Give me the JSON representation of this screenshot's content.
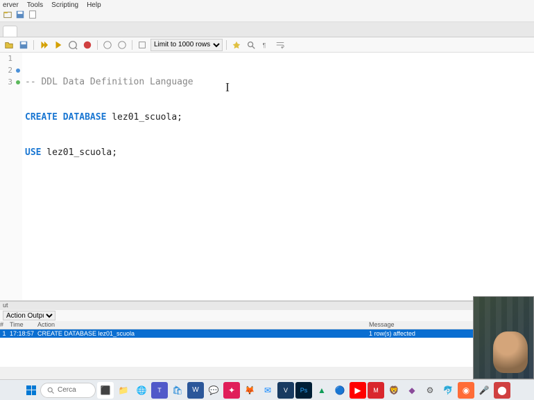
{
  "menu": {
    "items": [
      "erver",
      "Tools",
      "Scripting",
      "Help"
    ]
  },
  "toolbar2": {
    "limit_label": "Limit to 1000 rows"
  },
  "editor": {
    "lines": [
      {
        "num": "1",
        "marker": "",
        "comment": "-- DDL Data Definition Language"
      },
      {
        "num": "2",
        "marker": "blue",
        "kw1": "CREATE DATABASE",
        "ident": " lez01_scuola;"
      },
      {
        "num": "3",
        "marker": "green",
        "kw1": "USE",
        "ident": " lez01_scuola;"
      }
    ]
  },
  "output": {
    "tab": "ut",
    "dropdown": "Action Output",
    "headers": {
      "num": "#",
      "time": "Time",
      "action": "Action",
      "message": "Message"
    },
    "row": {
      "num": "1",
      "time": "17:18:57",
      "action": "CREATE DATABASE lez01_scuola",
      "message": "1 row(s) affected"
    }
  },
  "taskbar": {
    "search_placeholder": "Cerca",
    "icons": [
      "widgets",
      "explorer",
      "edge",
      "teams",
      "store",
      "word",
      "discord",
      "slack",
      "firefox",
      "thunderbird",
      "virtualbox",
      "photoshop",
      "drive",
      "chrome",
      "youtube",
      "mega",
      "brave",
      "unknown1",
      "settings",
      "mysql",
      "postman",
      "mic",
      "camera"
    ]
  }
}
